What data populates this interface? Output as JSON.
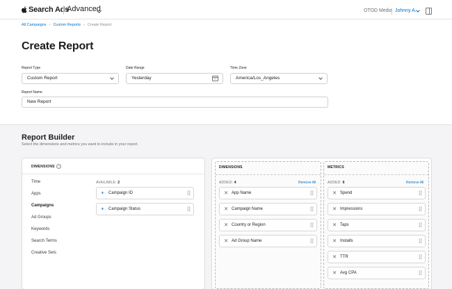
{
  "header": {
    "brand": "Search Ads",
    "product_menu": "Advanced",
    "org": "OTOD Media",
    "user": "Johnny A."
  },
  "breadcrumb": {
    "items": [
      "All Campaigns",
      "Custom Reports",
      "Create Report"
    ]
  },
  "page": {
    "title": "Create Report"
  },
  "form": {
    "report_type_label": "Report Type",
    "report_type_value": "Custom Report",
    "date_range_label": "Date Range",
    "date_range_value": "Yesterday",
    "time_zone_label": "Time Zone",
    "time_zone_value": "America/Los_Angeles",
    "report_name_label": "Report Name",
    "report_name_value": "New Report"
  },
  "builder": {
    "title": "Report Builder",
    "description": "Select the dimensions and metrics you want to include in your report.",
    "dimensions_heading": "DIMENSIONS",
    "help_glyph": "?",
    "categories": [
      "Time",
      "Apps",
      "Campaigns",
      "Ad Groups",
      "Keywords",
      "Search Terms",
      "Creative Sets"
    ],
    "active_category": "Campaigns",
    "available_label": "AVAILABLE:",
    "available_count": "2",
    "available_items": [
      "Campaign ID",
      "Campaign Status"
    ],
    "selected_dimensions": {
      "title": "DIMENSIONS",
      "added_label": "ADDED:",
      "added_count": "4",
      "remove_all": "Remove All",
      "items": [
        "App Name",
        "Campaign Name",
        "Country or Region",
        "Ad Group Name"
      ]
    },
    "selected_metrics": {
      "title": "METRICS",
      "added_label": "ADDED:",
      "added_count": "6",
      "remove_all": "Remove All",
      "items": [
        "Spend",
        "Impressions",
        "Taps",
        "Installs",
        "TTR",
        "Avg CPA"
      ]
    }
  }
}
